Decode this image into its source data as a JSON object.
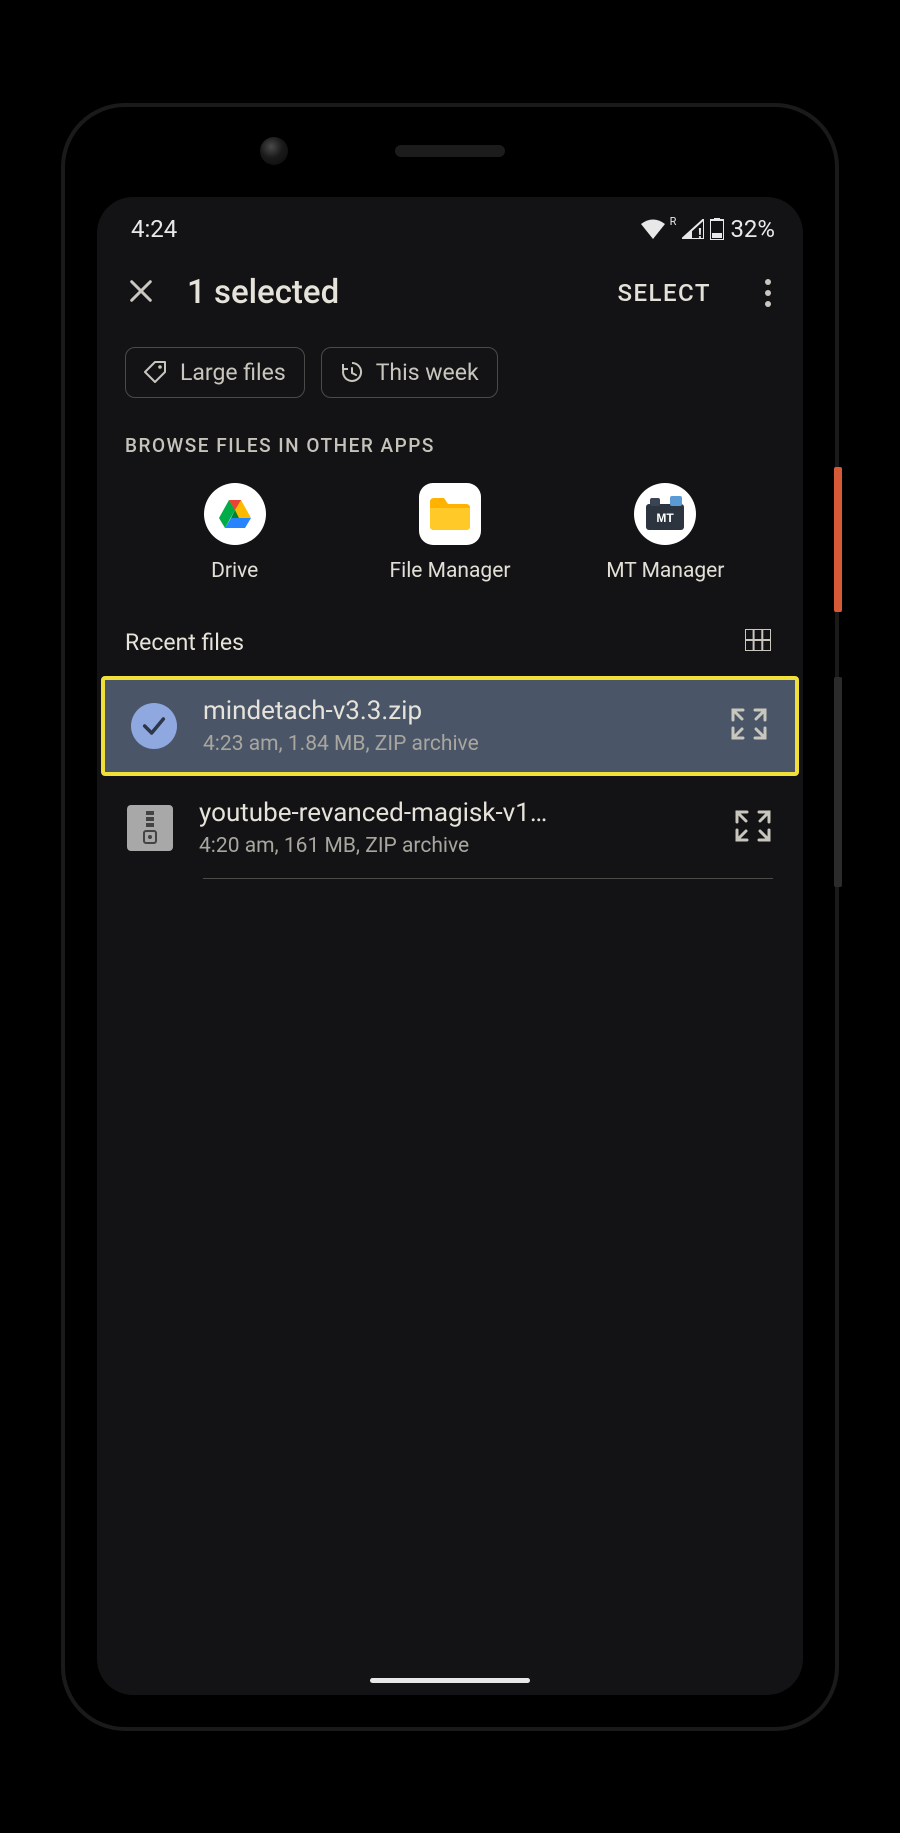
{
  "status": {
    "time": "4:24",
    "battery": "32%",
    "roaming": "R"
  },
  "header": {
    "title": "1 selected",
    "select_label": "SELECT"
  },
  "chips": {
    "large_files": "Large files",
    "this_week": "This week"
  },
  "browse": {
    "label": "BROWSE FILES IN OTHER APPS",
    "apps": [
      {
        "name": "Drive"
      },
      {
        "name": "File Manager"
      },
      {
        "name": "MT Manager"
      }
    ]
  },
  "recent": {
    "title": "Recent files",
    "files": [
      {
        "name": "mindetach-v3.3.zip",
        "meta": "4:23 am, 1.84 MB, ZIP archive",
        "selected": true
      },
      {
        "name": "youtube-revanced-magisk-v1…",
        "meta": "4:20 am, 161 MB, ZIP archive",
        "selected": false
      }
    ]
  }
}
